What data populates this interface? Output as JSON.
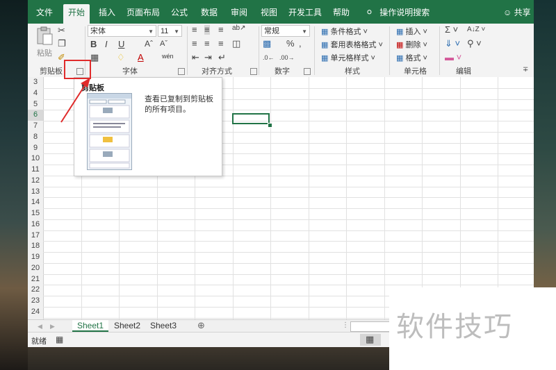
{
  "tabs": [
    "文件",
    "开始",
    "插入",
    "页面布局",
    "公式",
    "数据",
    "审阅",
    "视图",
    "开发工具",
    "帮助"
  ],
  "active_tab": "开始",
  "search_label": "操作说明搜索",
  "share_label": "共享",
  "ribbon": {
    "paste_label": "粘贴",
    "font_name": "宋体",
    "font_size": "11",
    "number_format": "常规",
    "styles": {
      "conditional": "条件格式",
      "table": "套用表格格式",
      "cell_styles": "单元格样式"
    },
    "cells": {
      "insert": "插入",
      "delete": "删除",
      "format": "格式"
    },
    "groups": {
      "clipboard": "剪贴板",
      "font": "字体",
      "alignment": "对齐方式",
      "number": "数字",
      "styles": "样式",
      "cells": "单元格",
      "editing": "编辑"
    },
    "bold": "B",
    "italic": "I",
    "underline": "U",
    "wen": "wén"
  },
  "tooltip": {
    "title": "剪贴板",
    "description": "查看已复制到剪贴板的所有项目。"
  },
  "rows": [
    "3",
    "4",
    "5",
    "6",
    "7",
    "8",
    "9",
    "10",
    "11",
    "12",
    "13",
    "14",
    "15",
    "16",
    "17",
    "18",
    "19",
    "20",
    "21",
    "22",
    "23",
    "24"
  ],
  "selected_row": "6",
  "sheets": [
    "Sheet1",
    "Sheet2",
    "Sheet3"
  ],
  "active_sheet": "Sheet1",
  "status": "就绪",
  "watermark": "软件技巧",
  "colors": {
    "accent": "#217346",
    "highlight": "#e02b2b"
  }
}
